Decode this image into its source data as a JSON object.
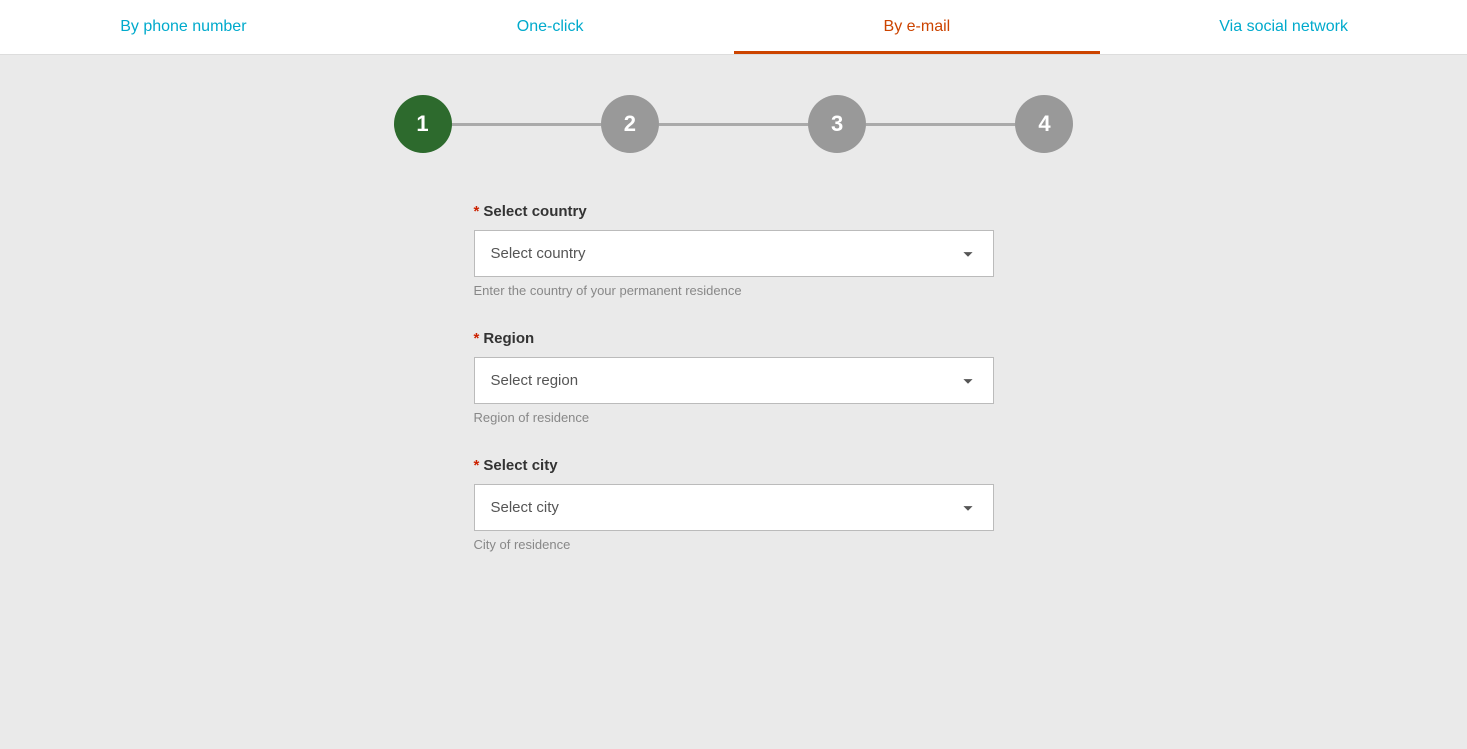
{
  "tabs": [
    {
      "id": "phone",
      "label": "By phone number",
      "active": false
    },
    {
      "id": "oneclick",
      "label": "One-click",
      "active": false
    },
    {
      "id": "email",
      "label": "By e-mail",
      "active": true
    },
    {
      "id": "social",
      "label": "Via social network",
      "active": false
    }
  ],
  "stepper": {
    "steps": [
      {
        "number": "1",
        "active": true
      },
      {
        "number": "2",
        "active": false
      },
      {
        "number": "3",
        "active": false
      },
      {
        "number": "4",
        "active": false
      }
    ]
  },
  "form": {
    "country": {
      "label": "Select country",
      "placeholder": "Select country",
      "hint": "Enter the country of your permanent residence",
      "options": [
        "Select country"
      ]
    },
    "region": {
      "label": "Region",
      "placeholder": "Select region",
      "hint": "Region of residence",
      "options": [
        "Select region"
      ]
    },
    "city": {
      "label": "Select city",
      "placeholder": "Select city",
      "hint": "City of residence",
      "options": [
        "Select city"
      ]
    }
  },
  "icons": {
    "chevron_down": "▾"
  }
}
